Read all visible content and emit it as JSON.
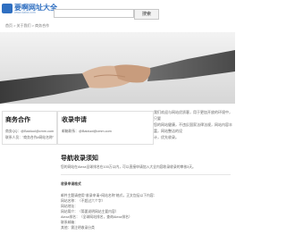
{
  "header": {
    "logo_text": "要啊网址大全",
    "logo_sub": "www.daba.com",
    "search_placeholder": "",
    "search_button": "搜索"
  },
  "breadcrumb": "首页 > 关于我们 > 商务合作",
  "hero": {
    "side_text": [
      "我们欢迎与网站优质客，用于更加开放的环境中，只要",
      "您的网站健康，不违反国家法律法规，网站内容丰富，网站整洁的设",
      "计，优先收录。"
    ]
  },
  "cooperation": {
    "title": "商务合作",
    "lines": [
      "商务QQ：@Baiduol@cmm.com",
      "联系人员：\"商务合作#网站名称\""
    ]
  },
  "collect": {
    "title": "收录申请",
    "lines": [
      "邮箱联系：@Baiduol@cmm.com"
    ]
  },
  "guide": {
    "title": "导航收录须知",
    "text": "您的网站在Alexa全球排名在100万以内，可以直接申请加入大全内容收录收录的审核3天。"
  },
  "format": {
    "title": "收录申请格式",
    "lines": [
      "邮件主题请使用\"收录申请+网站名称\"格式，正文包括以下内容：",
      "网站名称：（不超过六个字）",
      "网站地址：",
      "网站简介：（简要说明网站主要内容）",
      "Alexa排名：（全球网站排名，查询Alexa排名）",
      "联系邮箱：",
      "其他：需注明收录分类"
    ]
  },
  "colors": {
    "accent": "#2f6fc1",
    "text": "#333333",
    "muted": "#666666",
    "border": "#e0e0e0"
  }
}
